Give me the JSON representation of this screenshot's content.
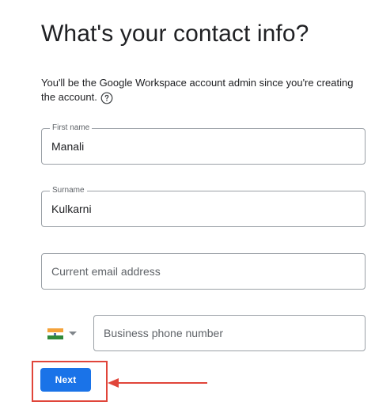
{
  "page": {
    "title": "What's your contact info?",
    "subtitle": "You'll be the Google Workspace account admin since you're creating the account."
  },
  "form": {
    "first_name": {
      "label": "First name",
      "value": "Manali"
    },
    "surname": {
      "label": "Surname",
      "value": "Kulkarni"
    },
    "email": {
      "placeholder": "Current email address"
    },
    "phone": {
      "placeholder": "Business phone number",
      "country_flag": "india-flag-icon"
    }
  },
  "actions": {
    "next_label": "Next"
  },
  "icons": {
    "help": "help-circle-icon",
    "dropdown": "chevron-down-icon"
  },
  "colors": {
    "primary": "#1a73e8",
    "annotation": "#e0453a",
    "border": "#9aa0a6"
  }
}
